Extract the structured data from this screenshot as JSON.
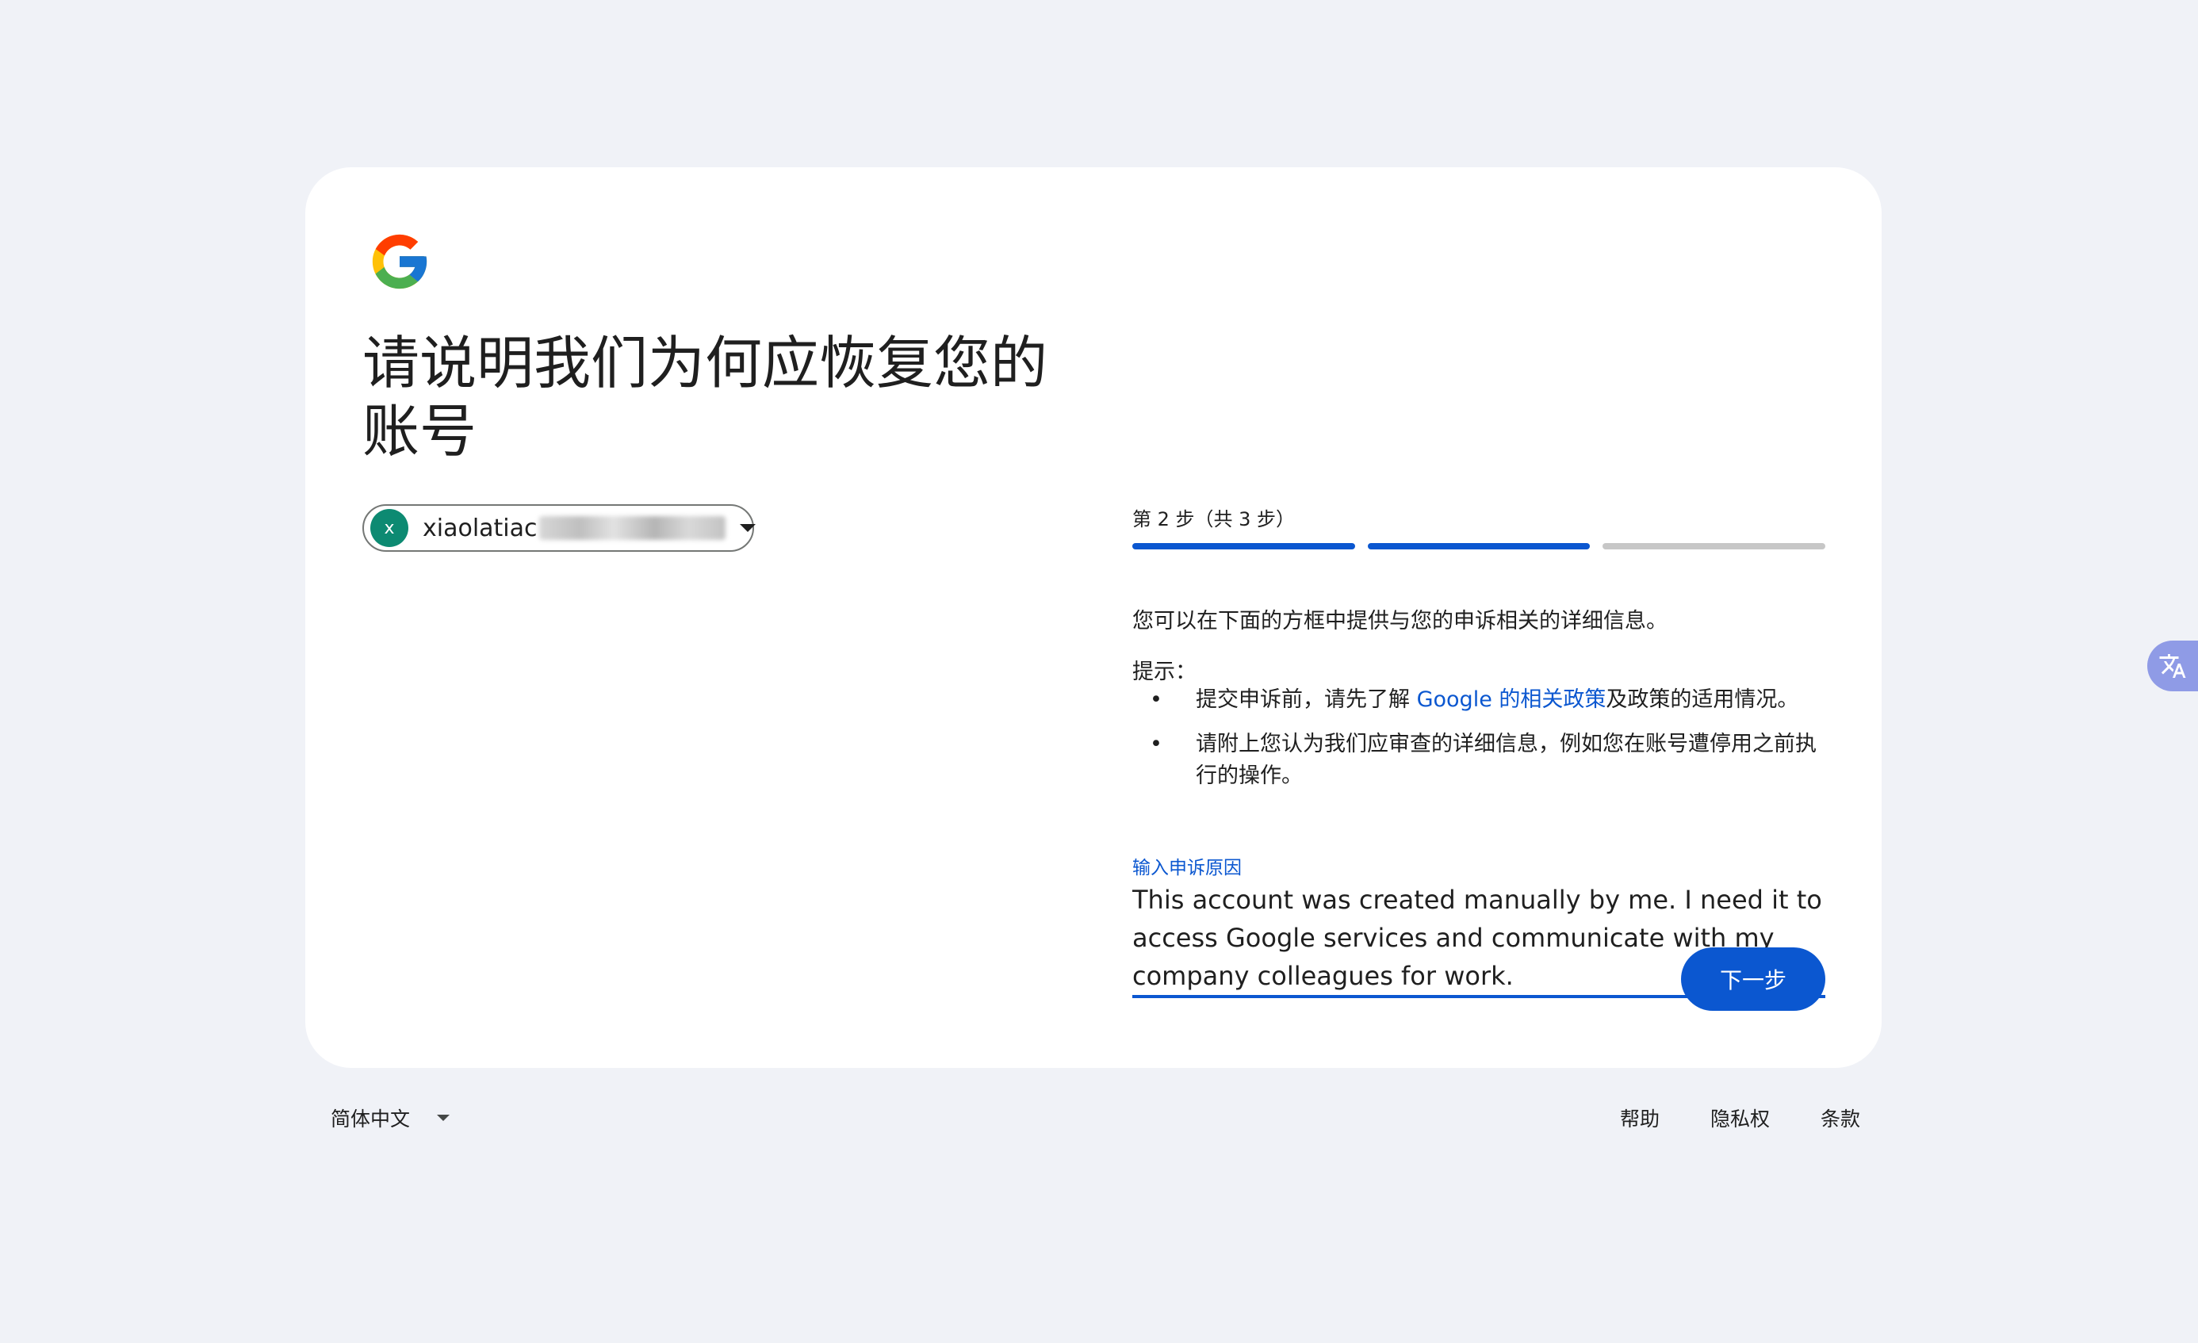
{
  "header": {
    "title": "请说明我们为何应恢复您的账号"
  },
  "account": {
    "avatar_letter": "x",
    "email_visible": "xiaolatiac"
  },
  "steps": {
    "label": "第 2 步（共 3 步）",
    "current": 2,
    "total": 3
  },
  "content": {
    "description": "您可以在下面的方框中提供与您的申诉相关的详细信息。",
    "tips_label": "提示：",
    "tip1_prefix": "提交申诉前，请先了解 ",
    "tip1_link": "Google 的相关政策",
    "tip1_suffix": "及政策的适用情况。",
    "tip2": "请附上您认为我们应审查的详细信息，例如您在账号遭停用之前执行的操作。"
  },
  "form": {
    "reason_label": "输入申诉原因",
    "reason_value": "This account was created manually by me. I need it to access Google services and communicate with my company colleagues for work."
  },
  "actions": {
    "next_label": "下一步"
  },
  "footer": {
    "language": "简体中文",
    "help": "帮助",
    "privacy": "隐私权",
    "terms": "条款"
  },
  "colors": {
    "accent": "#0b57d0",
    "background": "#f0f2f7",
    "avatar": "#0d8a72",
    "translate_fab": "#8f9be6"
  }
}
